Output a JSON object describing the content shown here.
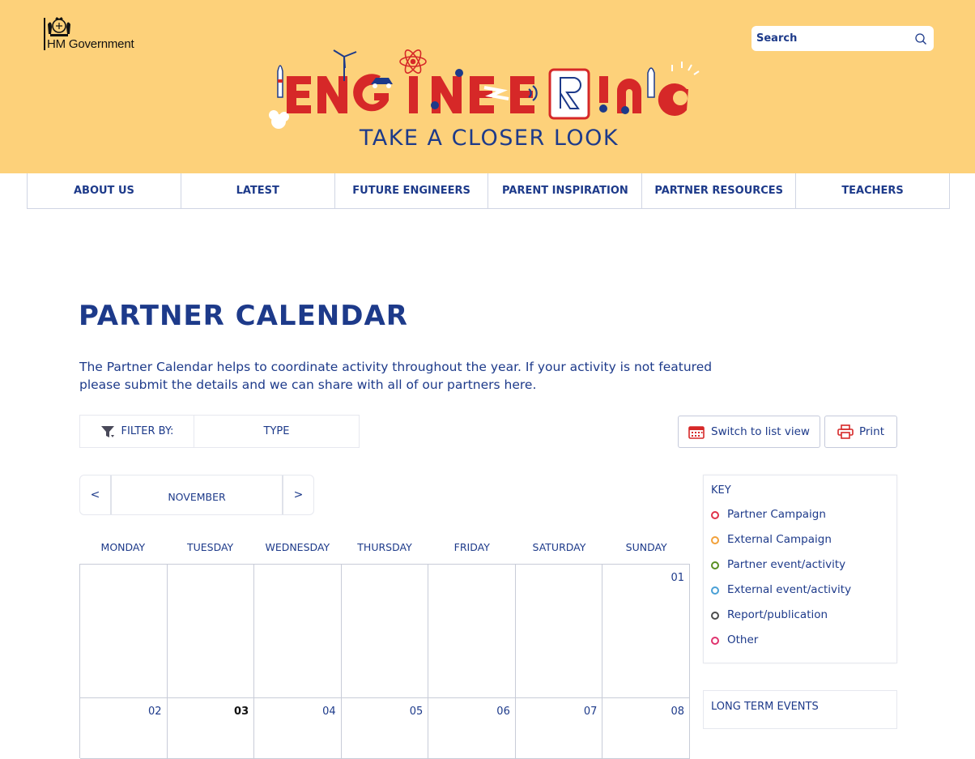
{
  "header": {
    "gov_logo_text": "HM Government",
    "brand_word": "ENGINEERING",
    "tagline": "TAKE A CLOSER LOOK",
    "search_placeholder": "Search",
    "colors": {
      "background": "#fdd17a",
      "brand_red": "#d62828",
      "brand_blue": "#1d3a8a"
    }
  },
  "nav": {
    "items": [
      {
        "label": "ABOUT US"
      },
      {
        "label": "LATEST"
      },
      {
        "label": "FUTURE ENGINEERS"
      },
      {
        "label": "PARENT INSPIRATION"
      },
      {
        "label": "PARTNER RESOURCES"
      },
      {
        "label": "TEACHERS"
      }
    ]
  },
  "main": {
    "title": "PARTNER CALENDAR",
    "intro": "The Partner Calendar helps to coordinate activity throughout the year. If your activity is not featured please submit the details and we can share with all of our partners here."
  },
  "filter": {
    "label": "FILTER BY:",
    "type_label": "TYPE",
    "icon": "filter-funnel-icon"
  },
  "actions": {
    "list_view_label": "Switch to list view",
    "print_label": "Print",
    "list_icon": "calendar-icon",
    "print_icon": "printer-icon"
  },
  "calendar": {
    "prev_label": "<",
    "next_label": ">",
    "month_label": "NOVEMBER",
    "weekdays": [
      "MONDAY",
      "TUESDAY",
      "WEDNESDAY",
      "THURSDAY",
      "FRIDAY",
      "SATURDAY",
      "SUNDAY"
    ],
    "week1": [
      "",
      "",
      "",
      "",
      "",
      "",
      "01"
    ],
    "week2": [
      "02",
      "03",
      "04",
      "05",
      "06",
      "07",
      "08"
    ],
    "highlighted_day": "03"
  },
  "key": {
    "title": "KEY",
    "items": [
      {
        "label": "Partner Campaign",
        "color": "#e0334a"
      },
      {
        "label": "External Campaign",
        "color": "#f2a13a"
      },
      {
        "label": "Partner event/activity",
        "color": "#5a8f22"
      },
      {
        "label": "External event/activity",
        "color": "#4aa0d6"
      },
      {
        "label": "Report/publication",
        "color": "#4d4d4d"
      },
      {
        "label": "Other",
        "color": "#e0336e"
      }
    ]
  },
  "long_term": {
    "title": "LONG TERM EVENTS"
  }
}
